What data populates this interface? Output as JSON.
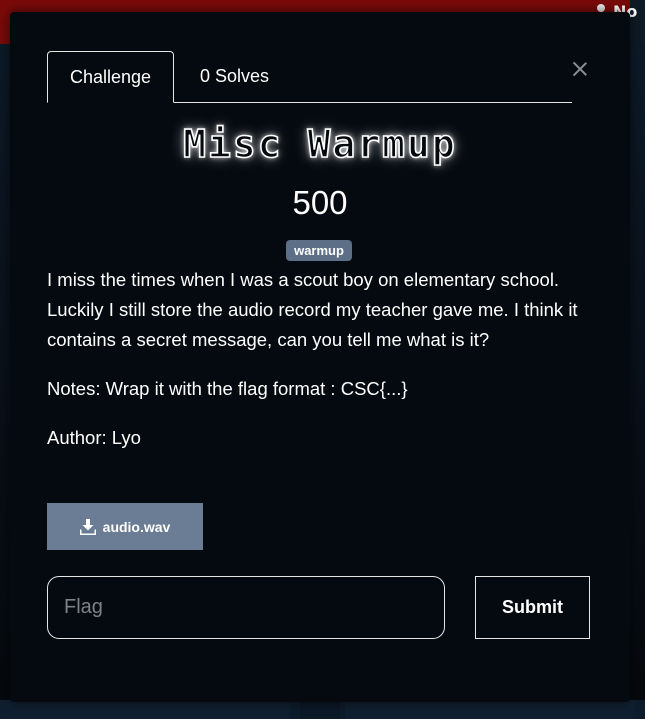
{
  "background": {
    "user_label": "No"
  },
  "modal": {
    "tabs": [
      {
        "label": "Challenge"
      },
      {
        "label": "0 Solves"
      }
    ],
    "title": "Misc Warmup",
    "value": "500",
    "tag": "warmup",
    "description": [
      "I miss the times when I was a scout boy on elementary school. Luckily I still store the audio record my teacher gave me. I think it contains a secret message, can you tell me what is it?",
      "Notes: Wrap it with the flag format : CSC{...}",
      "Author: Lyo"
    ],
    "file": {
      "label": "audio.wav",
      "icon": "download-icon"
    },
    "flag_input": {
      "placeholder": "Flag",
      "value": ""
    },
    "submit_label": "Submit",
    "colors": {
      "modal_bg": "#050a10",
      "tag_bg": "#5c6f86",
      "file_button_bg": "#6a7d95",
      "topbar": "#7a0a0a"
    }
  }
}
